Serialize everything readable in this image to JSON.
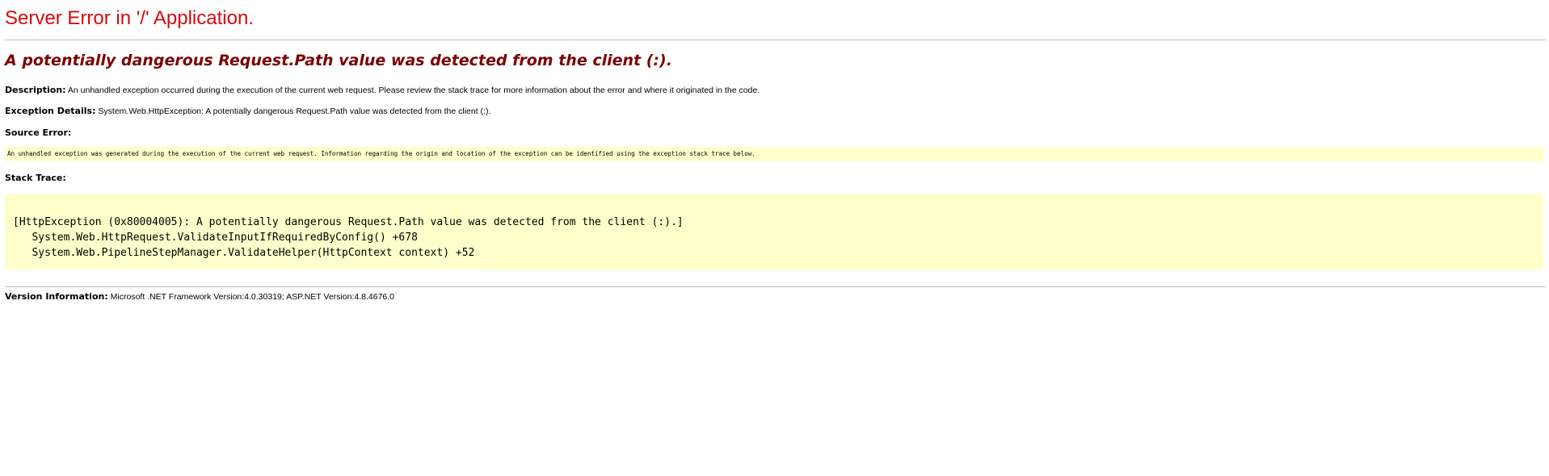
{
  "page": {
    "title": "Server Error in '/' Application.",
    "error_message": "A potentially dangerous Request.Path value was detected from the client (:).",
    "description": {
      "label": "Description:",
      "text": " An unhandled exception occurred during the execution of the current web request. Please review the stack trace for more information about the error and where it originated in the code."
    },
    "exception_details": {
      "label": "Exception Details:",
      "text": " System.Web.HttpException: A potentially dangerous Request.Path value was detected from the client (:)."
    },
    "source_error": {
      "label": "Source Error:",
      "text": "An unhandled exception was generated during the execution of the current web request. Information regarding the origin and location of the exception can be identified using the exception stack trace below."
    },
    "stack_trace": {
      "label": "Stack Trace:",
      "lines": [
        "[HttpException (0x80004005): A potentially dangerous Request.Path value was detected from the client (:).]",
        "   System.Web.HttpRequest.ValidateInputIfRequiredByConfig() +678",
        "   System.Web.PipelineStepManager.ValidateHelper(HttpContext context) +52"
      ]
    },
    "version_information": {
      "label": "Version Information:",
      "text": " Microsoft .NET Framework Version:4.0.30319; ASP.NET Version:4.8.4676.0"
    }
  },
  "colors": {
    "title": "#d40b0b",
    "error_message": "#7d0000",
    "code_box_background": "#ffffcc",
    "divider": "#c0c0c0"
  }
}
